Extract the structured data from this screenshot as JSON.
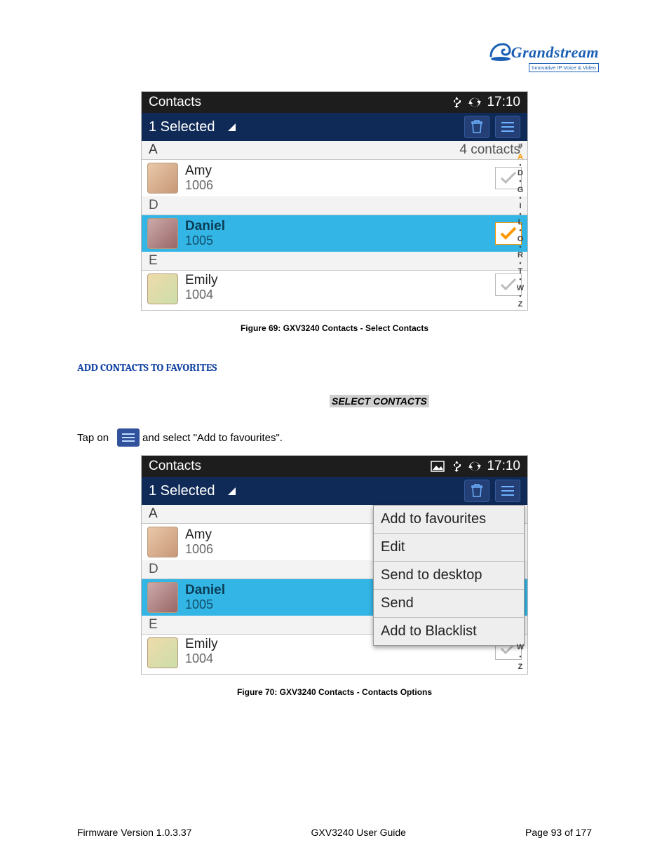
{
  "brand": {
    "name": "Grandstream",
    "caption": "Innovative IP Voice & Video"
  },
  "status": {
    "title": "Contacts",
    "time": "17:10"
  },
  "selbar": {
    "label": "1 Selected"
  },
  "list": {
    "count_label": "4 contacts",
    "sections": [
      {
        "letter": "A",
        "rows": [
          {
            "name": "Amy",
            "num": "1006",
            "checked": false,
            "selected": false
          }
        ]
      },
      {
        "letter": "D",
        "rows": [
          {
            "name": "Daniel",
            "num": "1005",
            "checked": true,
            "selected": true
          }
        ]
      },
      {
        "letter": "E",
        "rows": [
          {
            "name": "Emily",
            "num": "1004",
            "checked": false,
            "selected": false
          }
        ]
      }
    ],
    "index_letters": [
      "#",
      "A",
      "D",
      "G",
      "I",
      "L",
      "O",
      "R",
      "T",
      "W",
      "Z"
    ],
    "index_letters_short": [
      "W",
      "Z"
    ],
    "index_current": "A"
  },
  "fig1_caption": "Figure 69: GXV3240 Contacts - Select Contacts",
  "heading": "ADD CONTACTS TO FAVORITES",
  "subhead": "SELECT CONTACTS",
  "para_pre": "Tap on",
  "para_post": " and select \"Add to favourites\".",
  "menu_items": [
    "Add to favourites",
    "Edit",
    "Send to desktop",
    "Send",
    "Add to Blacklist"
  ],
  "fig2_caption": "Figure 70: GXV3240 Contacts - Contacts Options",
  "footer": {
    "left": "Firmware Version 1.0.3.37",
    "center": "GXV3240 User Guide",
    "right": "Page 93 of 177"
  }
}
